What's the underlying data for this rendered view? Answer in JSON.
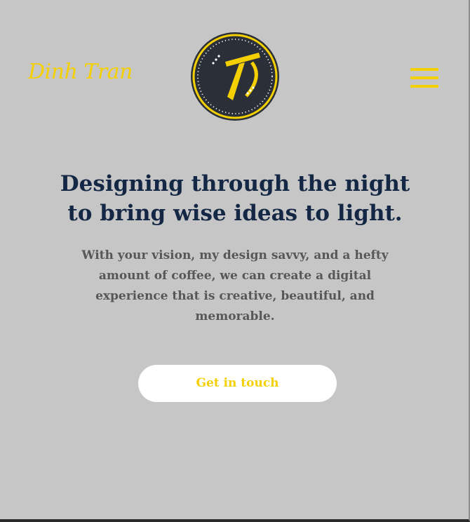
{
  "header": {
    "brand_name": "Dinh Tran",
    "logo_icon": "dt-monogram-badge",
    "menu_icon": "hamburger-icon"
  },
  "hero": {
    "headline_line1": "Designing through the night",
    "headline_line2": "to bring wise ideas to light.",
    "description": "With your vision, my design savvy, and a hefty amount of coffee, we can create a digital experience that is creative, beautiful, and memorable.",
    "cta_label": "Get in touch"
  },
  "colors": {
    "background": "#c6c6c6",
    "accent": "#f5d000",
    "headline": "#142846",
    "body_text": "#575757",
    "logo_fill": "#2a2f38",
    "button_bg": "#ffffff"
  }
}
